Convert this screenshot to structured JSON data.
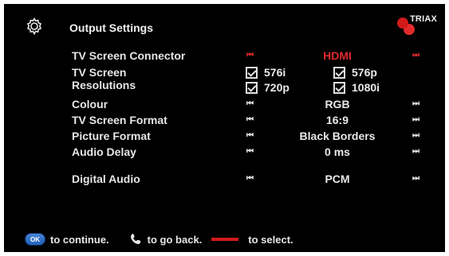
{
  "header": {
    "title": "Output Settings",
    "brand": "TRIAX",
    "icons": {
      "settings": "gear-icon",
      "brand": "triax-logo"
    }
  },
  "settings": [
    {
      "label": "TV Screen Connector",
      "value": "HDMI",
      "highlighted": true
    },
    {
      "label": "TV Screen Resolutions",
      "options": [
        "576i",
        "576p",
        "720p",
        "1080i"
      ]
    },
    {
      "label": "Colour",
      "value": "RGB",
      "highlighted": false
    },
    {
      "label": "TV Screen Format",
      "value": "16:9",
      "highlighted": false
    },
    {
      "label": "Picture Format",
      "value": "Black Borders",
      "highlighted": false
    },
    {
      "label": "Audio Delay",
      "value": "0 ms",
      "highlighted": false
    },
    {
      "label": "Digital Audio",
      "value": "PCM",
      "highlighted": false
    }
  ],
  "labels": {
    "tv_screen": "TV Screen",
    "resolutions": "Resolutions"
  },
  "footer": {
    "ok": "OK",
    "continue": "to continue.",
    "back": "to go back.",
    "select": "to select."
  },
  "colors": {
    "background": "#000000",
    "text": "#e6e6e6",
    "highlight": "#e12b2b",
    "ok_button": "#2e6fca"
  }
}
